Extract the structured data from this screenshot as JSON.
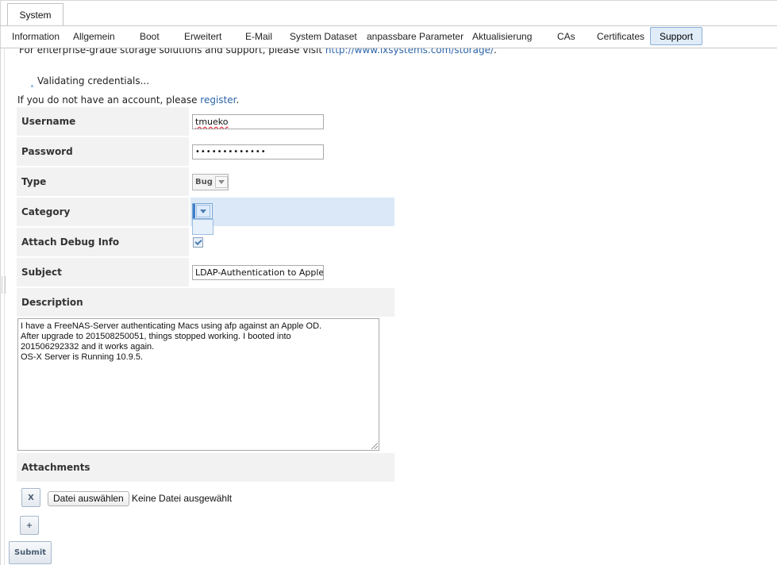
{
  "top_tab": {
    "label": "System"
  },
  "subtabs": [
    {
      "label": "Information",
      "active": false
    },
    {
      "label": "Allgemein",
      "active": false
    },
    {
      "label": "Boot",
      "active": false
    },
    {
      "label": "Erweitert",
      "active": false
    },
    {
      "label": "E-Mail",
      "active": false
    },
    {
      "label": "System Dataset",
      "active": false
    },
    {
      "label": "anpassbare Parameter",
      "active": false
    },
    {
      "label": "Aktualisierung",
      "active": false
    },
    {
      "label": "CAs",
      "active": false
    },
    {
      "label": "Certificates",
      "active": false
    },
    {
      "label": "Support",
      "active": true
    }
  ],
  "notice": {
    "prefix": "For enterprise-grade storage solutions and support, please visit ",
    "link": "http://www.ixsystems.com/storage/",
    "suffix": "."
  },
  "status": {
    "validating": "Validating credentials..."
  },
  "account": {
    "prefix": "If you do not have an account, please ",
    "link": "register",
    "suffix": "."
  },
  "form": {
    "username": {
      "label": "Username",
      "value": "tmueko"
    },
    "password": {
      "label": "Password",
      "value": "•••••••••••••"
    },
    "type": {
      "label": "Type",
      "value": "Bug"
    },
    "category": {
      "label": "Category",
      "value": ""
    },
    "attach_debug": {
      "label": "Attach Debug Info",
      "checked": true
    },
    "subject": {
      "label": "Subject",
      "value": "LDAP-Authentication to Apple"
    },
    "description": {
      "label": "Description",
      "value": "I have a FreeNAS-Server authenticating Macs using afp against an Apple OD.\nAfter upgrade to 201508250051, things stopped working. I booted into\n201506292332 and it works again.\nOS-X Server is Running 10.9.5."
    },
    "attachments": {
      "label": "Attachments",
      "remove_label": "X",
      "choose_file_label": "Datei auswählen",
      "no_file_text": "Keine Datei ausgewählt",
      "add_label": "+"
    },
    "submit_label": "Submit"
  },
  "colors": {
    "link": "#2c64a8",
    "highlight_row": "#dbe8f7",
    "active_tab": "#e0ecf8"
  }
}
